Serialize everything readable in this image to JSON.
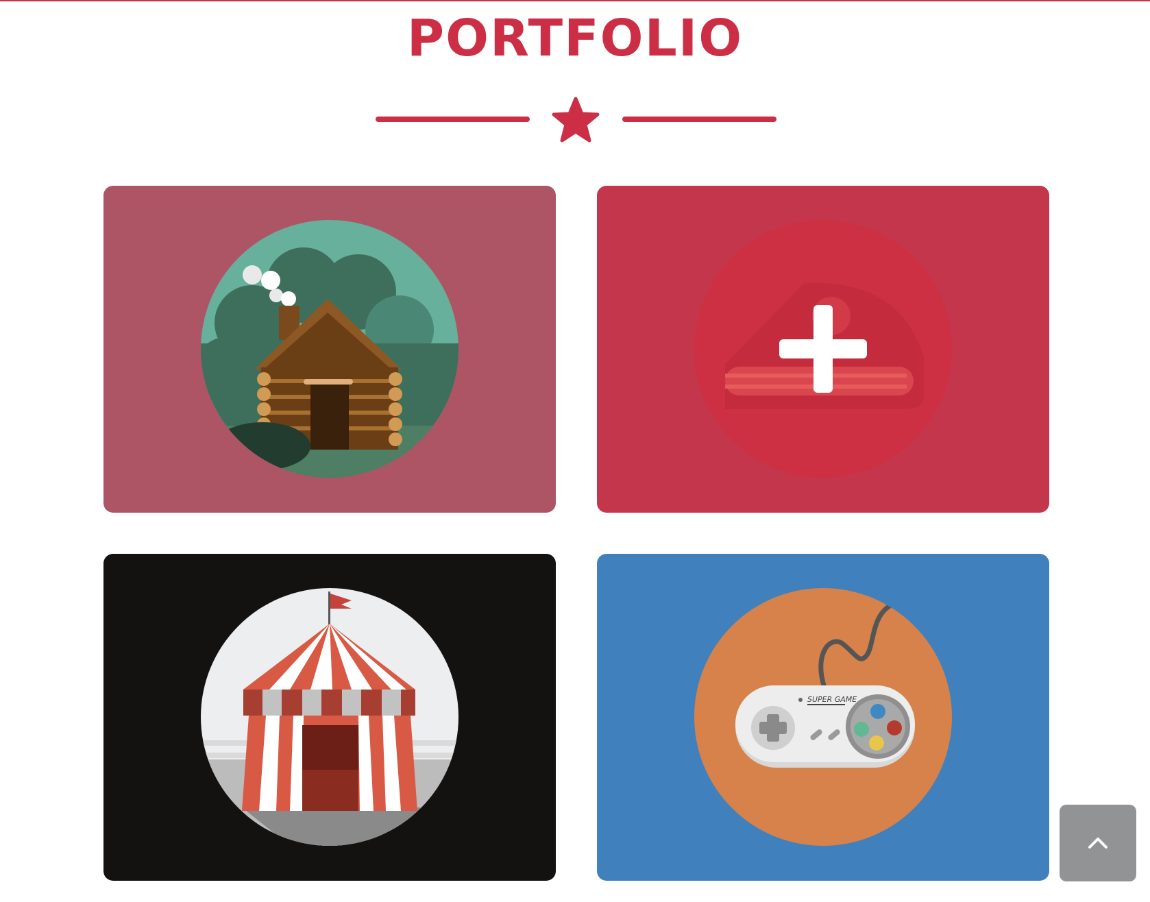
{
  "section": {
    "title": "PORTFOLIO"
  },
  "colors": {
    "accent": "#cc2f45",
    "scroll_button": "#929395"
  },
  "divider": {
    "icon": "star-icon"
  },
  "portfolio_items": [
    {
      "icon": "log-cabin-icon",
      "background": "#ad5565",
      "hovered": false
    },
    {
      "icon": "plus-icon",
      "background": "#c3364c",
      "hovered": true,
      "overlay_icon": "cake-icon"
    },
    {
      "icon": "circus-tent-icon",
      "background": "#131210",
      "hovered": false
    },
    {
      "icon": "game-controller-icon",
      "background": "#4081bd",
      "hovered": false,
      "controller_label": "SUPER GAME"
    }
  ],
  "scroll_top_button": {
    "icon": "chevron-up-icon"
  }
}
